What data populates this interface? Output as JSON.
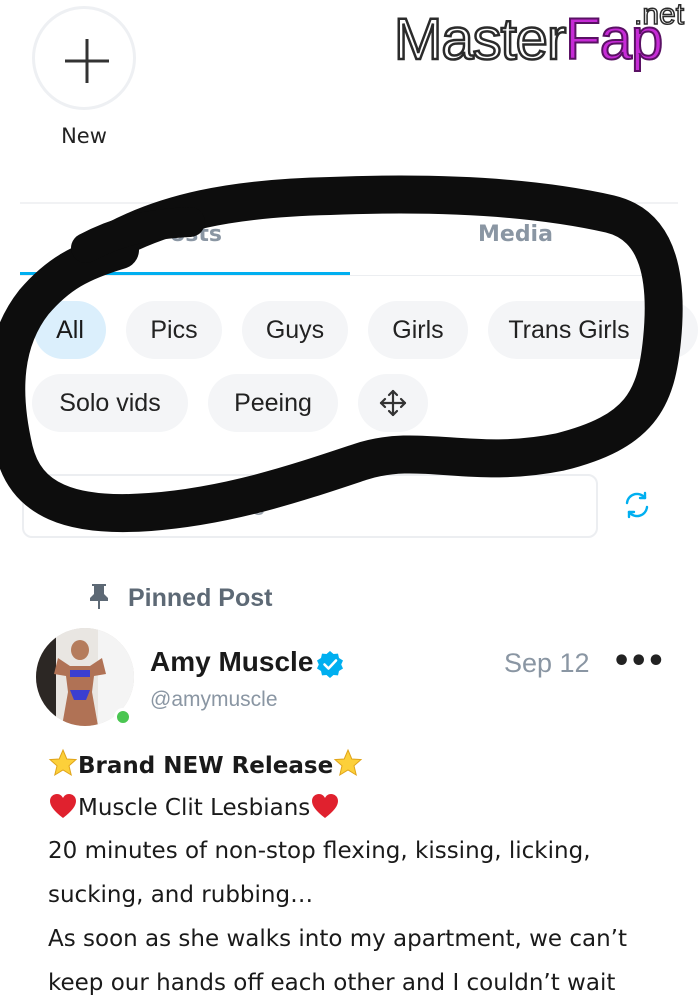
{
  "story": {
    "new_label": "New"
  },
  "watermark": {
    "part1": "Master",
    "part2": "Fap",
    "suffix": ".net"
  },
  "tabs": [
    {
      "label": "Posts",
      "active": true
    },
    {
      "label": "Media",
      "active": false
    }
  ],
  "filters": {
    "chips": [
      "All",
      "Pics",
      "Guys",
      "Girls",
      "Trans Girls",
      "Solo vids",
      "Peeing"
    ],
    "selected": "All",
    "reorder_icon": "move-icon"
  },
  "search": {
    "placeholder": "Search Timeline",
    "refresh_icon": "refresh-icon"
  },
  "pinned": {
    "label": "Pinned Post"
  },
  "post": {
    "author_name": "Amy Muscle",
    "handle": "@amymuscle",
    "date": "Sep 12",
    "verified": true,
    "online": true,
    "lines": [
      "Brand NEW Release",
      "Muscle Clit Lesbians",
      "20 minutes of non-stop flexing, kissing, licking,",
      "sucking, and rubbing…",
      "As soon as she walks into my apartment, we can’t",
      "keep our hands off each other and I couldn’t wait"
    ],
    "more_icon": "•••"
  },
  "colors": {
    "accent": "#00aff0",
    "chip_bg": "#f4f5f7",
    "chip_active_bg": "#dbeffc",
    "muted_text": "#8a96a3",
    "online": "#4ac651"
  }
}
